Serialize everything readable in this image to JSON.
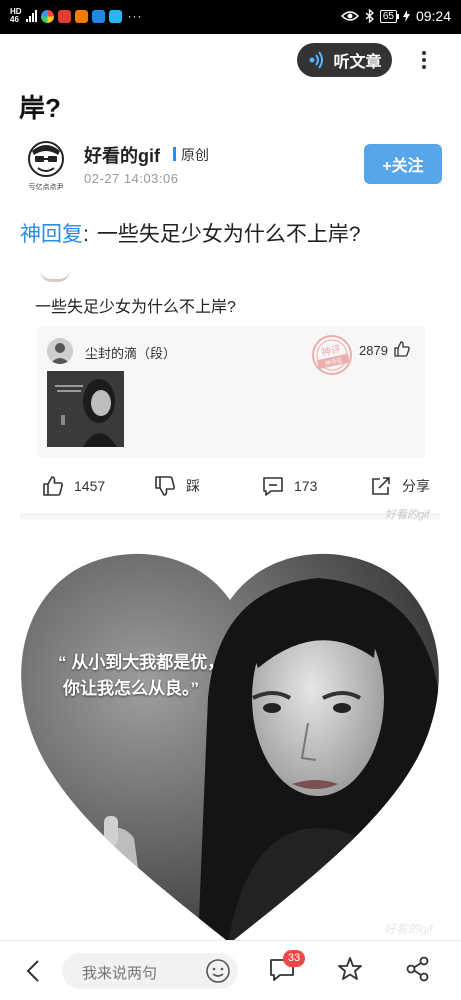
{
  "status_bar": {
    "network_hd": "HD",
    "network_gen": "46",
    "dots": "···",
    "battery": "65",
    "time": "09:24"
  },
  "header": {
    "listen_label": "听文章",
    "title_tail": "岸?"
  },
  "author": {
    "avatar_caption": "亏亿点点尹",
    "name": "好看的gif",
    "original_label": "原创",
    "time": "02-27 14:03:06",
    "follow_label": "+关注"
  },
  "article": {
    "tag": "神回复",
    "colon": ":",
    "question": "一些失足少女为什么不上岸?"
  },
  "embedded_card": {
    "question": "一些失足少女为什么不上岸?",
    "commenter": "尘封的滴（段）",
    "comment_likes": "2879",
    "stamp_text": "神评",
    "stamp_sub": "神评论",
    "actions": {
      "like_count": "1457",
      "dislike_label": "踩",
      "comment_count": "173",
      "share_label": "分享"
    },
    "watermark": "好看的gif"
  },
  "heart_image": {
    "quote_line1": "“ 从小到大我都是优，",
    "quote_line2": "你让我怎么从良。”",
    "watermark": "好看的gif"
  },
  "bottom_bar": {
    "comment_placeholder": "我来说两句",
    "comment_badge": "33"
  },
  "colors": {
    "accent_blue": "#2b8ce8",
    "follow_bg": "#58a6ea",
    "badge_red": "#f04848",
    "listen_bg": "#333333"
  }
}
